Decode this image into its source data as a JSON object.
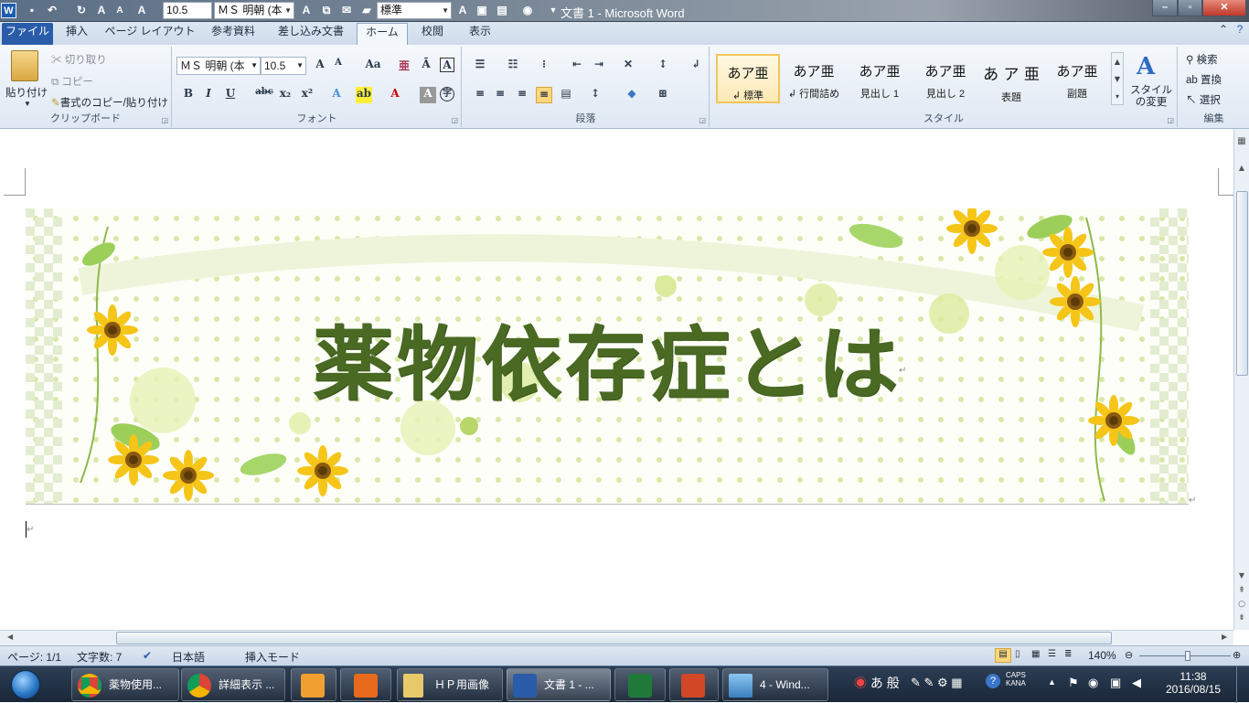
{
  "title_bar": {
    "window_title": "文書 1 - Microsoft Word",
    "qat_font_size": "10.5",
    "qat_font_name": "ＭＳ 明朝 (本",
    "qat_style": "標準",
    "minimize": "–",
    "maximize": "▫",
    "close": "✕"
  },
  "tabs": [
    {
      "label": "ファイル"
    },
    {
      "label": "挿入"
    },
    {
      "label": "ページ レイアウト"
    },
    {
      "label": "参考資料"
    },
    {
      "label": "差し込み文書"
    },
    {
      "label": "ホーム"
    },
    {
      "label": "校閲"
    },
    {
      "label": "表示"
    }
  ],
  "ribbon": {
    "clipboard": {
      "paste": "貼り付け",
      "cut": "切り取り",
      "copy": "コピー",
      "format_painter": "書式のコピー/貼り付け",
      "group": "クリップボード"
    },
    "font": {
      "font_name": "ＭＳ 明朝 (本",
      "font_size": "10.5",
      "group": "フォント"
    },
    "paragraph": {
      "group": "段落"
    },
    "styles": {
      "items": [
        {
          "preview": "あア亜",
          "name": "↲ 標準"
        },
        {
          "preview": "あア亜",
          "name": "↲ 行間詰め"
        },
        {
          "preview": "あア亜",
          "name": "見出し 1"
        },
        {
          "preview": "あア亜",
          "name": "見出し 2"
        },
        {
          "preview": "あ ア 亜",
          "name": "表題"
        },
        {
          "preview": "あア亜",
          "name": "副題"
        }
      ],
      "change_styles": "スタイルの変更",
      "group": "スタイル"
    },
    "editing": {
      "find": "検索",
      "replace": "置換",
      "select": "選択",
      "group": "編集"
    }
  },
  "document": {
    "banner_title": "薬物依存症とは"
  },
  "status_bar": {
    "page": "ページ: 1/1",
    "word_count": "文字数: 7",
    "language": "日本語",
    "mode": "挿入モード",
    "zoom": "140%"
  },
  "taskbar": {
    "items": [
      {
        "label": "薬物使用..."
      },
      {
        "label": "詳細表示 ..."
      },
      {
        "label": ""
      },
      {
        "label": ""
      },
      {
        "label": "ＨＰ用画像"
      },
      {
        "label": "文書 1 - ..."
      },
      {
        "label": ""
      },
      {
        "label": ""
      },
      {
        "label": "4 - Wind..."
      }
    ],
    "ime": "あ 般",
    "caps": "CAPS",
    "kana": "KANA",
    "time": "11:38",
    "date": "2016/08/15"
  },
  "colors": {
    "title_green": "#4a6a24",
    "file_tab": "#2a5caa"
  }
}
